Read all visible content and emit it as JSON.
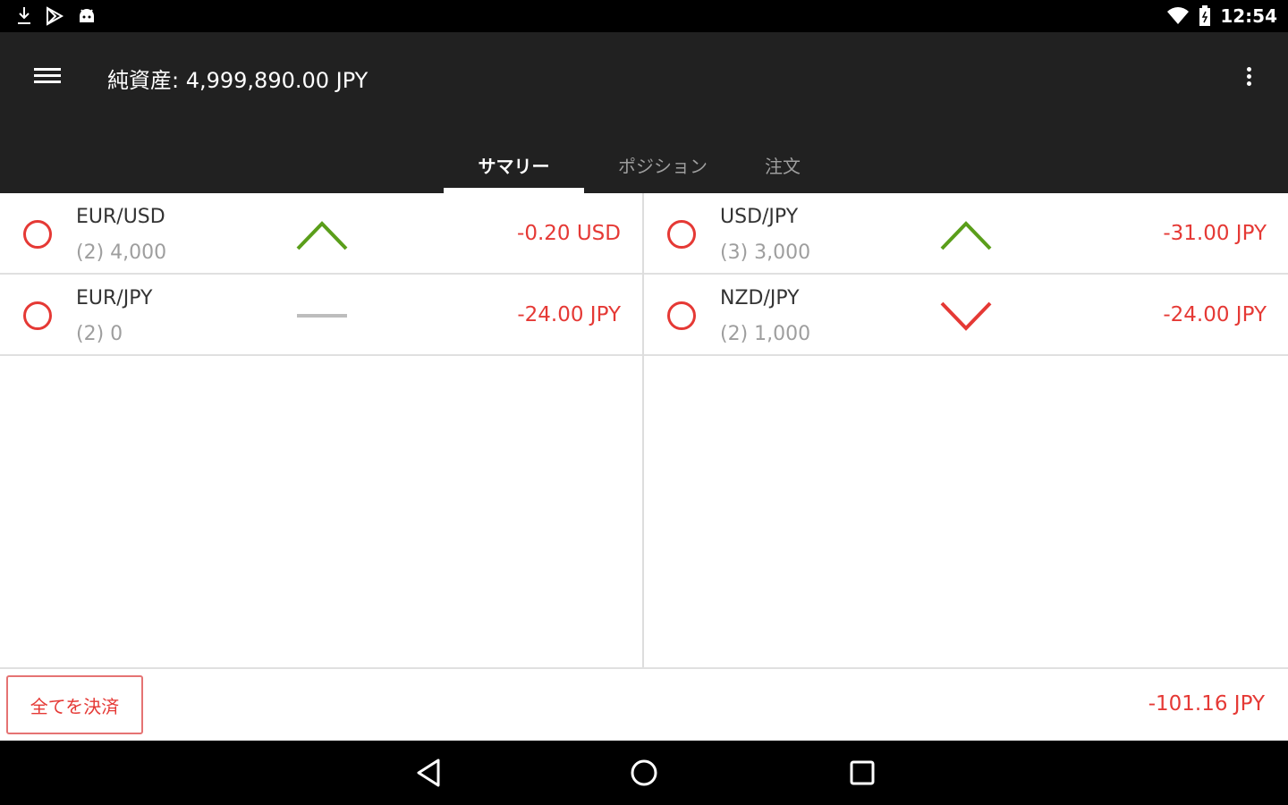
{
  "status_bar": {
    "time": "12:54",
    "icons": [
      "download-icon",
      "play-store-icon",
      "android-icon",
      "wifi-icon",
      "battery-icon"
    ]
  },
  "app_bar": {
    "title": "純資産: 4,999,890.00 JPY",
    "icons": [
      "menu-icon",
      "overflow-icon"
    ]
  },
  "tabs": [
    {
      "label": "サマリー",
      "active": true
    },
    {
      "label": "ポジション",
      "active": false
    },
    {
      "label": "注文",
      "active": false
    }
  ],
  "positions": [
    {
      "pair": "EUR/USD",
      "amount": "(2) 4,000",
      "trend": "up",
      "pnl": "-0.20 USD"
    },
    {
      "pair": "USD/JPY",
      "amount": "(3) 3,000",
      "trend": "up",
      "pnl": "-31.00 JPY"
    },
    {
      "pair": "EUR/JPY",
      "amount": "(2) 0",
      "trend": "flat",
      "pnl": "-24.00 JPY"
    },
    {
      "pair": "NZD/JPY",
      "amount": "(2) 1,000",
      "trend": "down",
      "pnl": "-24.00 JPY"
    }
  ],
  "footer": {
    "close_all_label": "全てを決済",
    "total_pnl": "-101.16 JPY"
  },
  "colors": {
    "app_bar": "#212121",
    "loss": "#e53935",
    "trend_up": "#5a9e1a",
    "trend_down": "#e53935",
    "trend_flat": "#bdbdbd"
  }
}
